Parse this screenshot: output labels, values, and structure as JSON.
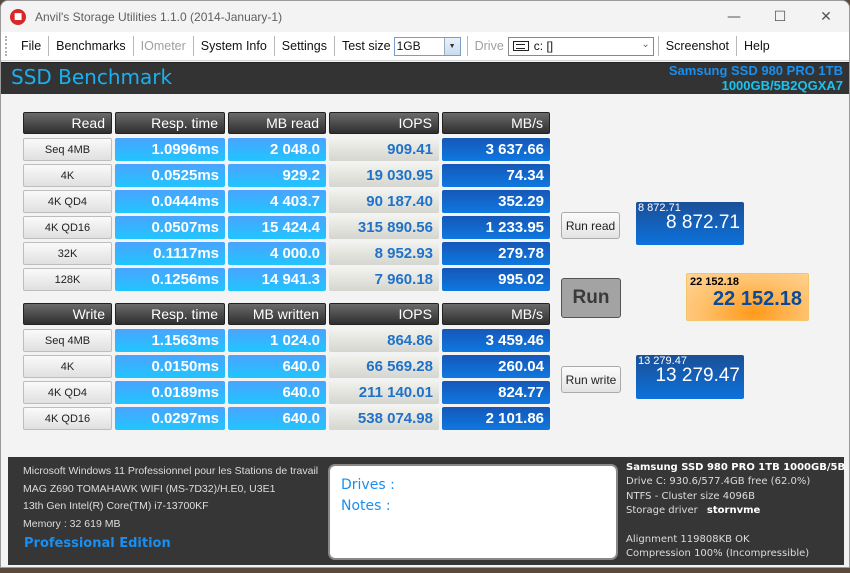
{
  "window": {
    "title": "Anvil's Storage Utilities 1.1.0 (2014-January-1)",
    "controls": [
      "minimize",
      "maximize",
      "close"
    ]
  },
  "menu": {
    "file": "File",
    "benchmarks": "Benchmarks",
    "iometer": "IOmeter",
    "system_info": "System Info",
    "settings": "Settings",
    "test_size_label": "Test size",
    "test_size_value": "1GB",
    "drive_label": "Drive",
    "drive_value": "c: []",
    "screenshot": "Screenshot",
    "help": "Help"
  },
  "header": {
    "title": "SSD Benchmark",
    "model_line1": "Samsung SSD 980 PRO 1TB",
    "model_line2": "1000GB/5B2QGXA7"
  },
  "read_table": {
    "headers": [
      "Read",
      "Resp. time",
      "MB read",
      "IOPS",
      "MB/s"
    ],
    "rows": [
      {
        "label": "Seq 4MB",
        "resp": "1.0996ms",
        "mb": "2 048.0",
        "iops": "909.41",
        "mbs": "3 637.66"
      },
      {
        "label": "4K",
        "resp": "0.0525ms",
        "mb": "929.2",
        "iops": "19 030.95",
        "mbs": "74.34"
      },
      {
        "label": "4K QD4",
        "resp": "0.0444ms",
        "mb": "4 403.7",
        "iops": "90 187.40",
        "mbs": "352.29"
      },
      {
        "label": "4K QD16",
        "resp": "0.0507ms",
        "mb": "15 424.4",
        "iops": "315 890.56",
        "mbs": "1 233.95"
      },
      {
        "label": "32K",
        "resp": "0.1117ms",
        "mb": "4 000.0",
        "iops": "8 952.93",
        "mbs": "279.78"
      },
      {
        "label": "128K",
        "resp": "0.1256ms",
        "mb": "14 941.3",
        "iops": "7 960.18",
        "mbs": "995.02"
      }
    ]
  },
  "write_table": {
    "headers": [
      "Write",
      "Resp. time",
      "MB written",
      "IOPS",
      "MB/s"
    ],
    "rows": [
      {
        "label": "Seq 4MB",
        "resp": "1.1563ms",
        "mb": "1 024.0",
        "iops": "864.86",
        "mbs": "3 459.46"
      },
      {
        "label": "4K",
        "resp": "0.0150ms",
        "mb": "640.0",
        "iops": "66 569.28",
        "mbs": "260.04"
      },
      {
        "label": "4K QD4",
        "resp": "0.0189ms",
        "mb": "640.0",
        "iops": "211 140.01",
        "mbs": "824.77"
      },
      {
        "label": "4K QD16",
        "resp": "0.0297ms",
        "mb": "640.0",
        "iops": "538 074.98",
        "mbs": "2 101.86"
      }
    ]
  },
  "actions": {
    "run_read": "Run read",
    "run": "Run",
    "run_write": "Run write"
  },
  "scores": {
    "read_small": "8 872.71",
    "read_big": "8 872.71",
    "total_small": "22 152.18",
    "total_big": "22 152.18",
    "write_small": "13 279.47",
    "write_big": "13 279.47"
  },
  "system": {
    "os": "Microsoft Windows 11 Professionnel pour les Stations de travail",
    "board": "MAG Z690 TOMAHAWK WIFI (MS-7D32)/H.E0, U3E1",
    "cpu": "13th Gen Intel(R) Core(TM) i7-13700KF",
    "memory": "Memory : 32 619 MB",
    "edition": "Professional Edition"
  },
  "notes": {
    "drives_label": "Drives :",
    "notes_label": "Notes :"
  },
  "drive_info": {
    "model": "Samsung SSD 980 PRO 1TB 1000GB/5B",
    "space": "Drive C: 930.6/577.4GB free (62.0%)",
    "fs": "NTFS - Cluster size 4096B",
    "driver_label": "Storage driver",
    "driver_value": "stornvme",
    "alignment": "Alignment 119808KB OK",
    "compression": "Compression 100% (Incompressible)"
  }
}
